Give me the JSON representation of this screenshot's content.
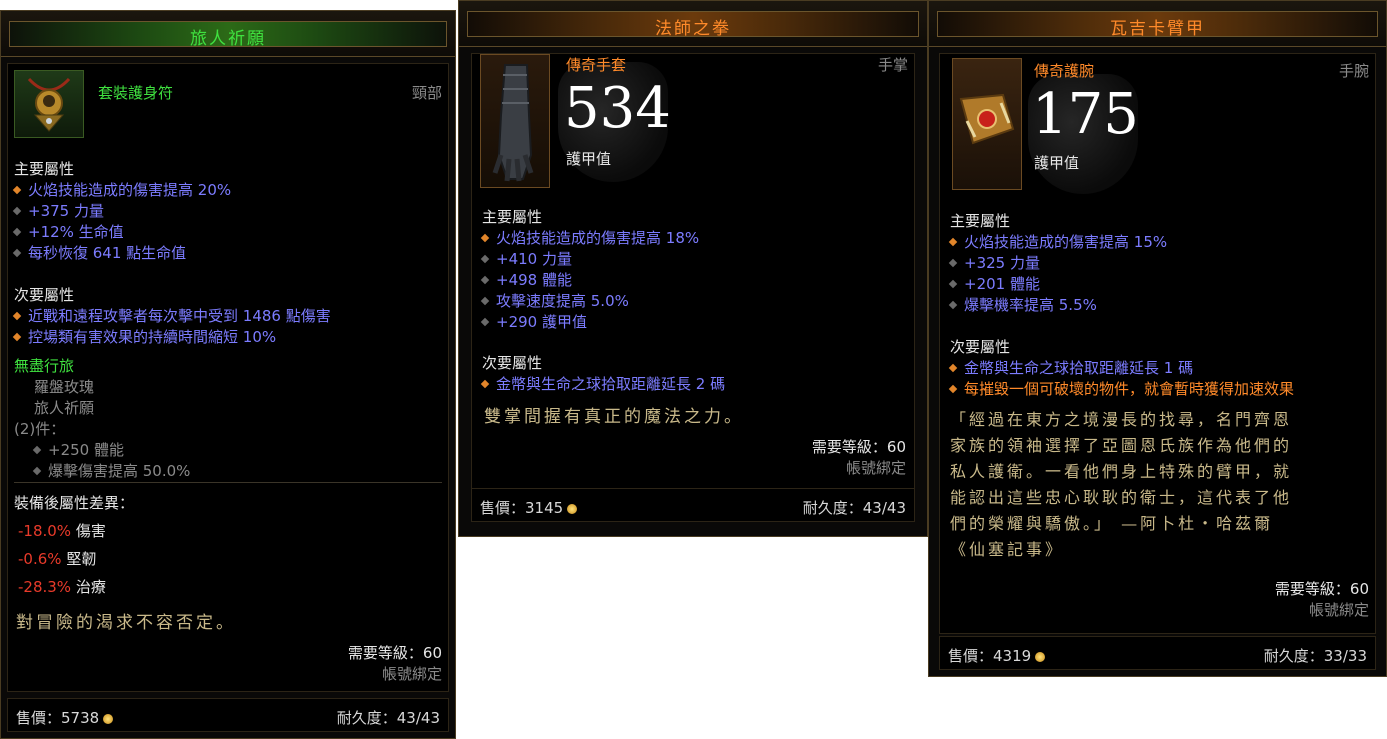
{
  "panel1": {
    "title": "旅人祈願",
    "item_type": "套裝護身符",
    "slot": "頸部",
    "primary_header": "主要屬性",
    "primary": [
      "火焰技能造成的傷害提高 20%",
      "+375 力量",
      "+12% 生命值",
      "每秒恢復 641 點生命值"
    ],
    "secondary_header": "次要屬性",
    "secondary": [
      "近戰和遠程攻擊者每次擊中受到 1486 點傷害",
      "控場類有害效果的持續時間縮短 10%"
    ],
    "set_name": "無盡行旅",
    "set_pieces": [
      "羅盤玫瑰",
      "旅人祈願"
    ],
    "set_bonus_count": "(2)件：",
    "set_bonuses": [
      "+250 體能",
      "爆擊傷害提高 50.0%"
    ],
    "diff_header": "裝備後屬性差異：",
    "diffs": [
      {
        "value": "-18.0%",
        "label": "傷害"
      },
      {
        "value": "-0.6%",
        "label": "堅韌"
      },
      {
        "value": "-28.3%",
        "label": "治療"
      }
    ],
    "flavor": "對冒險的渴求不容否定。",
    "required_level": "需要等級：60",
    "bound": "帳號綁定",
    "sell_price": "售價：5738",
    "durability": "耐久度：43/43"
  },
  "panel2": {
    "title": "法師之拳",
    "item_type": "傳奇手套",
    "slot": "手掌",
    "armor": "534",
    "armor_label": "護甲值",
    "primary_header": "主要屬性",
    "primary": [
      "火焰技能造成的傷害提高 18%",
      "+410 力量",
      "+498 體能",
      "攻擊速度提高 5.0%",
      "+290 護甲值"
    ],
    "secondary_header": "次要屬性",
    "secondary": [
      "金幣與生命之球拾取距離延長 2 碼"
    ],
    "flavor": "雙掌間握有真正的魔法之力。",
    "required_level": "需要等級：60",
    "bound": "帳號綁定",
    "sell_price": "售價：3145",
    "durability": "耐久度：43/43"
  },
  "panel3": {
    "title": "瓦吉卡臂甲",
    "item_type": "傳奇護腕",
    "slot": "手腕",
    "armor": "175",
    "armor_label": "護甲值",
    "primary_header": "主要屬性",
    "primary": [
      "火焰技能造成的傷害提高 15%",
      "+325 力量",
      "+201 體能",
      "爆擊機率提高 5.5%"
    ],
    "secondary_header": "次要屬性",
    "secondary": [
      "金幣與生命之球拾取距離延長 1 碼",
      "每摧毀一個可破壞的物件，就會暫時獲得加速效果"
    ],
    "flavor_lines": [
      "「經過在東方之境漫長的找尋，名門齊恩",
      "家族的領袖選擇了亞圖恩氏族作為他們的",
      "私人護衛。一看他們身上特殊的臂甲，就",
      "能認出這些忠心耿耿的衛士，這代表了他",
      "們的榮耀與驕傲。」 —阿卜杜・哈茲爾",
      "《仙塞記事》"
    ],
    "required_level": "需要等級：60",
    "bound": "帳號綁定",
    "sell_price": "售價：4319",
    "durability": "耐久度：33/33"
  },
  "colors": {
    "set_green": "#3fe03f",
    "legendary_orange": "#ff8a2a",
    "magic_blue": "#7c7cff",
    "negative_red": "#e83a2a",
    "flavor_gold": "#c9b98a"
  },
  "icons": [
    "amulet-icon",
    "gauntlet-icon",
    "bracer-icon",
    "gold-coin-icon",
    "bullet-diamond-icon"
  ]
}
